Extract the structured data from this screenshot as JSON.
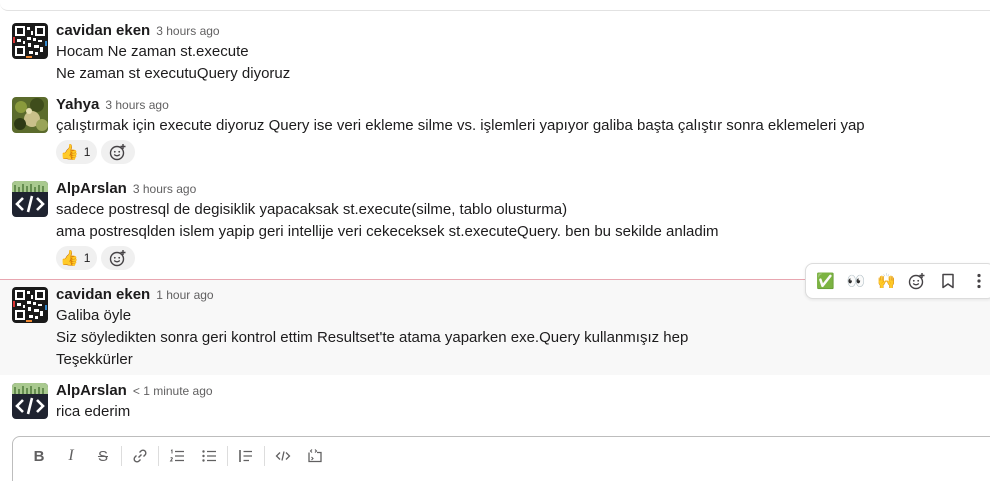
{
  "messages": [
    {
      "author": "cavidan eken",
      "time": "3 hours ago",
      "lines": [
        "Hocam Ne zaman st.execute",
        "Ne zaman st executuQuery diyoruz"
      ]
    },
    {
      "author": "Yahya",
      "time": "3 hours ago",
      "lines": [
        "çalıştırmak için execute diyoruz Query ise veri ekleme silme vs. işlemleri yapıyor galiba başta çalıştır sonra eklemeleri yap"
      ],
      "reactions": [
        {
          "emoji": "👍",
          "count": "1"
        }
      ]
    },
    {
      "author": "AlpArslan",
      "time": "3 hours ago",
      "lines": [
        "sadece postresql de degisiklik yapacaksak st.execute(silme, tablo olusturma)",
        "ama postresqlden islem yapip geri intellije veri cekeceksek st.executeQuery. ben bu sekilde anladim"
      ],
      "reactions": [
        {
          "emoji": "👍",
          "count": "1"
        }
      ]
    },
    {
      "author": "cavidan eken",
      "time": "1 hour ago",
      "lines": [
        "Galiba öyle",
        "Siz söyledikten sonra geri kontrol ettim Resultset'te atama yaparken exe.Query kullanmışız hep",
        "Teşekkürler"
      ]
    },
    {
      "author": "AlpArslan",
      "time": "< 1 minute ago",
      "lines": [
        "rica ederim"
      ]
    }
  ],
  "hover_actions": {
    "check": "✅",
    "eyes": "👀",
    "raised_hands": "🙌",
    "add_reaction": "add-reaction-icon",
    "bookmark": "bookmark-icon",
    "more": "more-vertical-icon"
  },
  "composer": {
    "bold": "B",
    "italic": "I",
    "strike": "S"
  },
  "colors": {
    "new_divider": "#e8a6b0",
    "hover_bg": "#f8f8f8",
    "reaction_bg": "#f0f0f0"
  }
}
